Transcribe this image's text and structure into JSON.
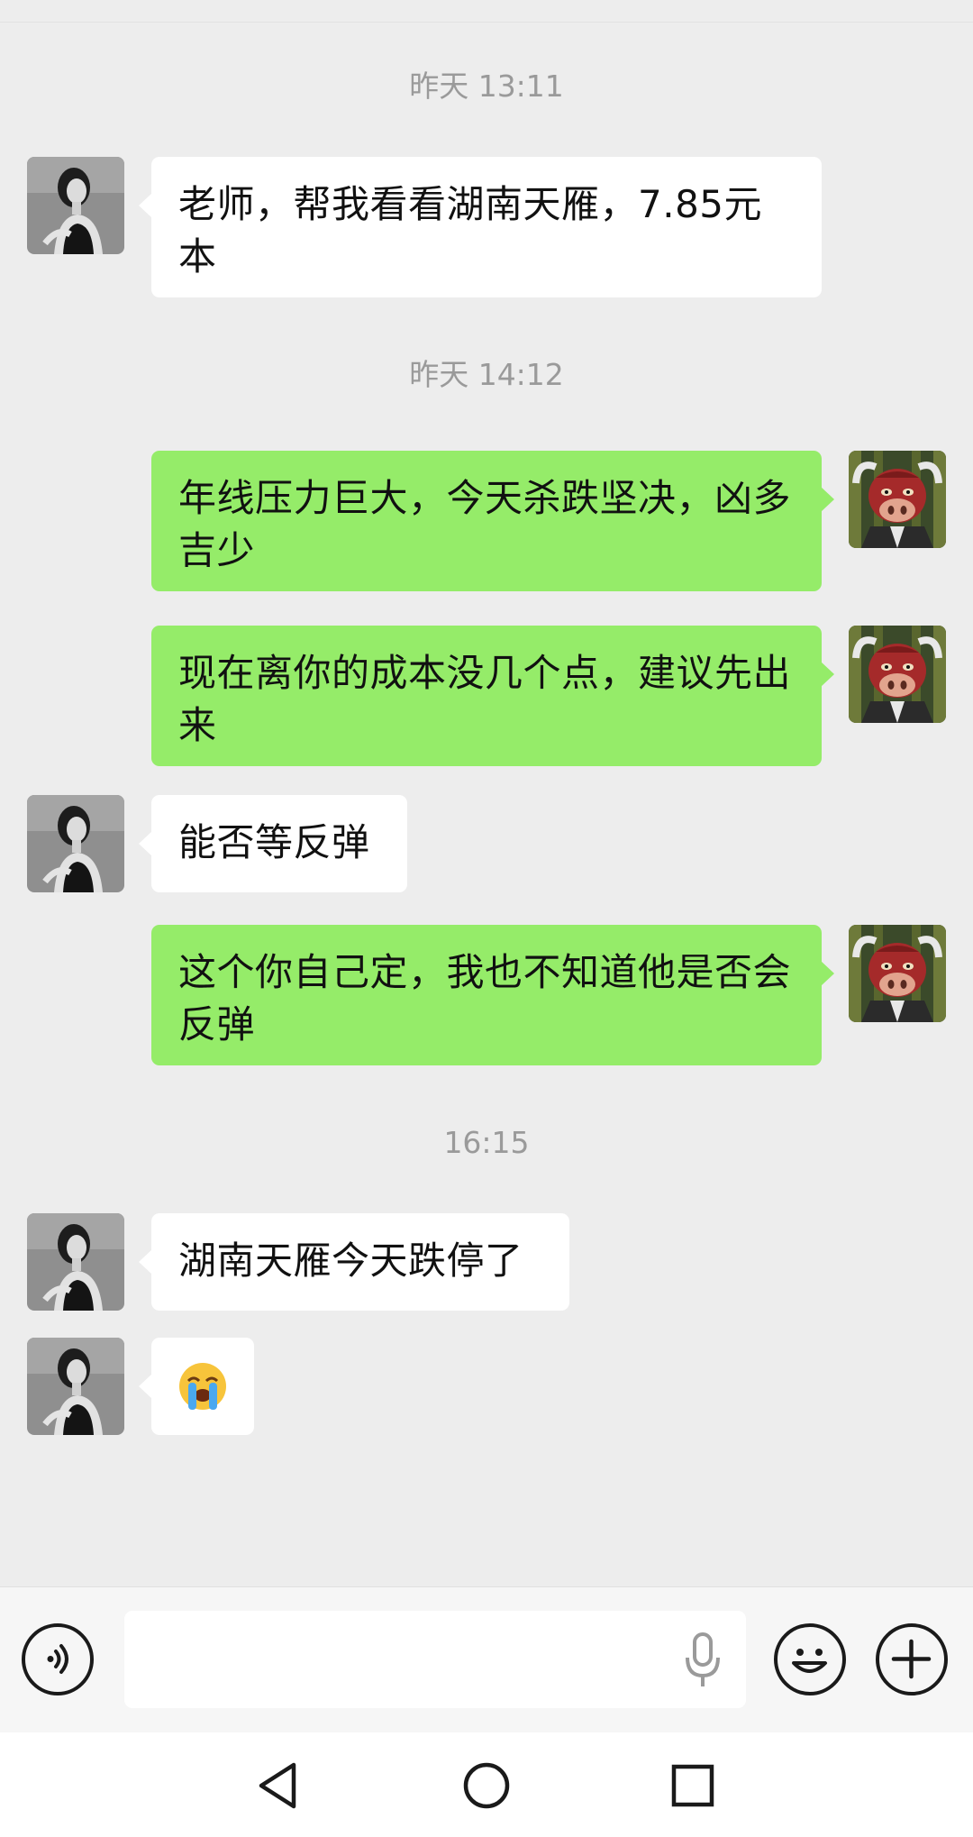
{
  "timestamps": [
    "昨天 13:11",
    "昨天 14:12",
    "16:15"
  ],
  "messages": [
    {
      "sender": "contact",
      "text": "老师，帮我看看湖南天雁，7.85元本"
    },
    {
      "sender": "me",
      "text": "年线压力巨大，今天杀跌坚决，凶多吉少"
    },
    {
      "sender": "me",
      "text": "现在离你的成本没几个点，建议先出来"
    },
    {
      "sender": "contact",
      "text": "能否等反弹"
    },
    {
      "sender": "me",
      "text": "这个你自己定，我也不知道他是否会反弹"
    },
    {
      "sender": "contact",
      "text": "湖南天雁今天跌停了"
    },
    {
      "sender": "contact",
      "type": "emoji",
      "emoji": "loudly-crying-face"
    }
  ],
  "input_bar": {
    "voice_icon": "voice-mode-icon",
    "input_value": "",
    "mic_icon": "microphone-icon",
    "emoji_icon": "smiley-icon",
    "plus_icon": "plus-icon"
  },
  "nav_bar": {
    "back_icon": "triangle-back-icon",
    "home_icon": "circle-home-icon",
    "recents_icon": "square-recents-icon"
  },
  "colors": {
    "background": "#ededed",
    "bubble_incoming": "#ffffff",
    "bubble_outgoing": "#95ec69",
    "timestamp_text": "#9a9a9a"
  }
}
